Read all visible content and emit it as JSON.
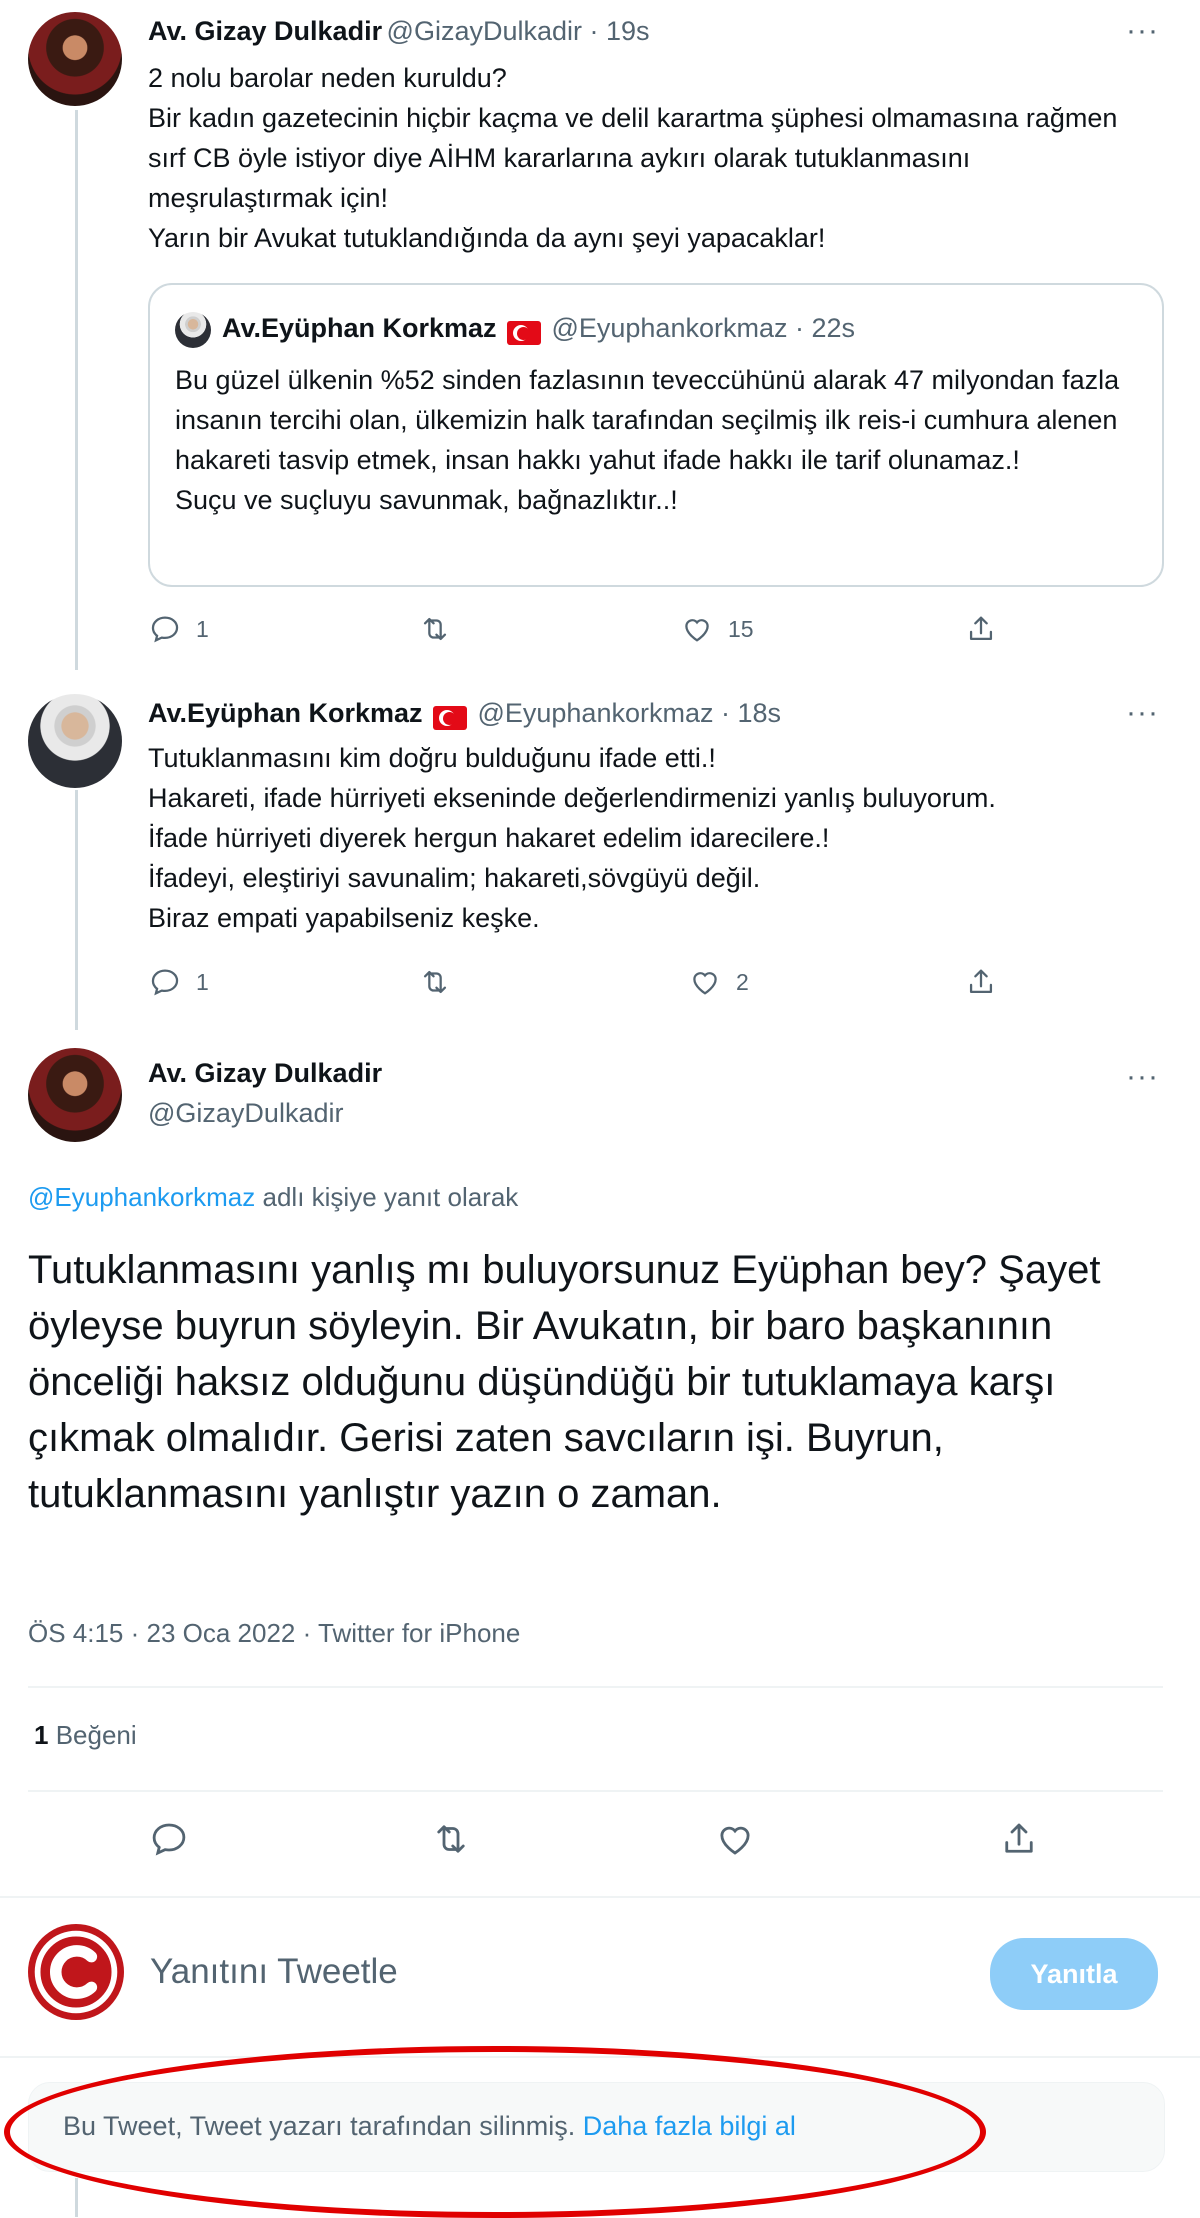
{
  "tweet1": {
    "name": "Av. Gizay Dulkadir",
    "handle": "@GizayDulkadir · 19s",
    "text": "2 nolu barolar neden kuruldu?\nBir kadın gazetecinin hiçbir kaçma ve delil karartma şüphesi olmamasına rağmen sırf CB öyle istiyor diye AİHM kararlarına aykırı olarak tutuklanmasını meşrulaştırmak için!\nYarın bir Avukat tutuklandığında da aynı şeyi yapacaklar!",
    "replies": "1",
    "likes": "15"
  },
  "quote": {
    "name": "Av.Eyüphan Korkmaz",
    "handle": "@Eyuphankorkmaz · 22s",
    "text": "Bu güzel ülkenin %52 sinden fazlasının teveccühünü alarak 47 milyondan fazla insanın tercihi olan, ülkemizin halk tarafından seçilmiş ilk reis-i cumhura alenen hakareti tasvip etmek, insan hakkı yahut ifade hakkı ile tarif olunamaz.!\nSuçu ve suçluyu savunmak, bağnazlıktır..!"
  },
  "tweet2": {
    "name": "Av.Eyüphan Korkmaz",
    "handle": "@Eyuphankorkmaz · 18s",
    "text": "Tutuklanmasını kim doğru bulduğunu ifade etti.!\nHakareti, ifade hürriyeti ekseninde değerlendirmenizi yanlış buluyorum.\nİfade hürriyeti diyerek hergun hakaret edelim idarecilere.!\nİfadeyi, eleştiriyi savunalim; hakareti,sövgüyü değil.\nBiraz empati yapabilseniz keşke.",
    "replies": "1",
    "likes": "2"
  },
  "main": {
    "name": "Av. Gizay Dulkadir",
    "handle": "@GizayDulkadir",
    "reply_to_handle": "@Eyuphankorkmaz",
    "reply_to_suffix": "adlı kişiye yanıt olarak",
    "text": "Tutuklanmasını yanlış mı buluyorsunuz Eyüphan bey? Şayet öyleyse buyrun söyleyin. Bir Avukatın, bir baro başkanının önceliği haksız olduğunu düşündüğü bir tutuklamaya karşı çıkmak olmalıdır. Gerisi zaten savcıların işi. Buyrun, tutuklanmasını yanlıştır yazın o zaman.",
    "meta": "ÖS 4:15 · 23 Oca 2022 · Twitter for iPhone",
    "likes_count": "1",
    "likes_label": "Beğeni"
  },
  "compose": {
    "placeholder": "Yanıtını Tweetle",
    "button": "Yanıtla"
  },
  "deleted": {
    "text": "Bu Tweet, Tweet yazarı tarafından silinmiş.",
    "link": "Daha fazla bilgi al"
  },
  "more_label": "···",
  "colors": {
    "link": "#1d9bf0",
    "muted": "#536471",
    "reply_button": "#8ecdf8",
    "highlight_ring": "#e00000"
  }
}
